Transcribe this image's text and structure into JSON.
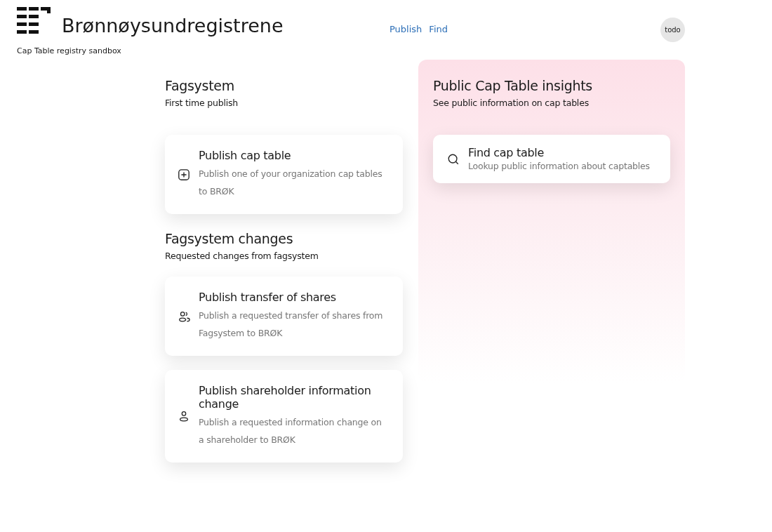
{
  "header": {
    "brand": "Brønnøysundregistrene",
    "subtitle": "Cap Table registry sandbox",
    "nav": [
      "Publish",
      "Find"
    ],
    "avatar": "todo"
  },
  "left_sections": [
    {
      "title": "Fagsystem",
      "subtitle": "First time publish",
      "cards": [
        {
          "kind": "create",
          "title": "Publish cap table",
          "description": "Publish one of your organization cap tables to BRØK"
        }
      ]
    },
    {
      "title": "Fagsystem changes",
      "subtitle": "Requested changes from fagsystem",
      "cards": [
        {
          "kind": "transfer",
          "title": "Publish transfer of shares",
          "description": "Publish a requested transfer of shares from Fagsystem to BRØK"
        },
        {
          "kind": "shareholder",
          "title": "Publish shareholder information change",
          "description": "Publish a requested information change on a shareholder to BRØK"
        }
      ]
    }
  ],
  "insights": {
    "title": "Public Cap Table insights",
    "subtitle": "See public information on cap tables",
    "cards": [
      {
        "kind": "lookup",
        "title": "Find cap table",
        "description": "Lookup public information about captables"
      }
    ]
  }
}
